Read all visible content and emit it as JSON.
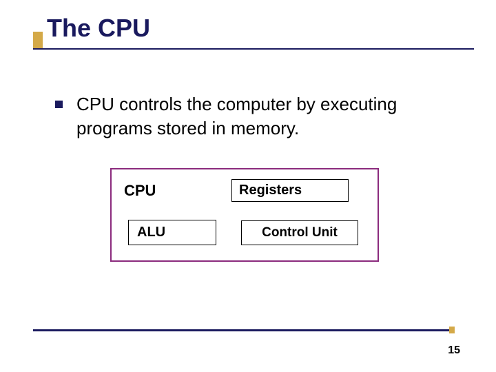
{
  "title": "The CPU",
  "bullet": "CPU controls the computer by executing programs stored in memory.",
  "diagram": {
    "cpu": "CPU",
    "registers": "Registers",
    "alu": "ALU",
    "control_unit": "Control Unit"
  },
  "page_number": "15"
}
